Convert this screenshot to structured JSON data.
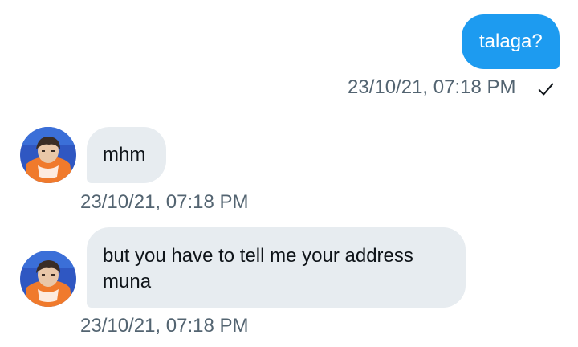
{
  "messages": [
    {
      "direction": "sent",
      "text": "talaga?",
      "timestamp": "23/10/21, 07:18 PM",
      "status_icon": "check-icon"
    },
    {
      "direction": "received",
      "text": "mhm",
      "timestamp": "23/10/21, 07:18 PM",
      "avatar_icon": "user-avatar"
    },
    {
      "direction": "received",
      "text": "but you have to tell me your address muna",
      "timestamp": "23/10/21, 07:18 PM",
      "avatar_icon": "user-avatar"
    }
  ],
  "colors": {
    "sent_bubble": "#1d9bf0",
    "received_bubble": "#e7ecf0",
    "timestamp": "#536471",
    "text_dark": "#0f1419"
  }
}
